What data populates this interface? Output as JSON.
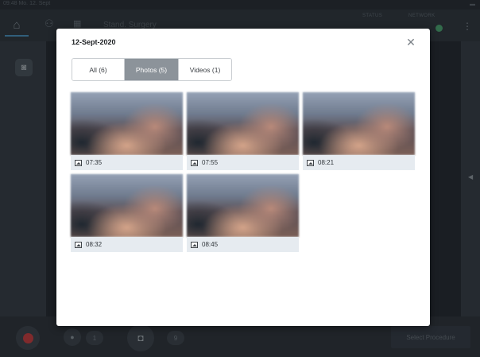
{
  "status_bar": {
    "time": "09:48  Mo. 12. Sept"
  },
  "header": {
    "title": "Stand. Surgery",
    "status_label": "STATUS",
    "network_label": "NETWORK"
  },
  "bottom": {
    "mic_count": "1",
    "photo_count": "9",
    "select_procedure": "Select Procedure"
  },
  "modal": {
    "title": "12-Sept-2020",
    "close_glyph": "✕",
    "tabs": [
      {
        "label": "All (6)",
        "active": false
      },
      {
        "label": "Photos (5)",
        "active": true
      },
      {
        "label": "Videos (1)",
        "active": false
      }
    ],
    "photos": [
      {
        "time": "07:35"
      },
      {
        "time": "07:55"
      },
      {
        "time": "08:21"
      },
      {
        "time": "08:32"
      },
      {
        "time": "08:45"
      }
    ]
  },
  "colors": {
    "active_tab": "#8c939a",
    "record": "#d93a3a",
    "status_ok": "#4caf72"
  }
}
